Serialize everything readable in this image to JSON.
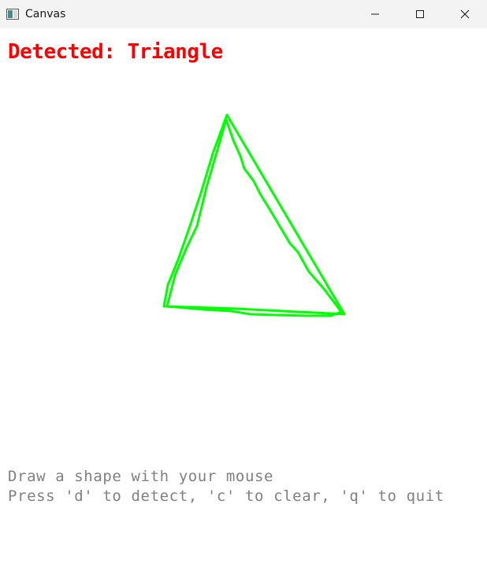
{
  "window": {
    "title": "Canvas",
    "icon": "app-window-icon",
    "controls": {
      "minimize_icon": "minimize-icon",
      "maximize_icon": "maximize-icon",
      "close_icon": "close-icon"
    }
  },
  "canvas": {
    "detected_text": "Detected: Triangle",
    "detected_color": "#ff0000",
    "stroke_color": "#00ff00",
    "shape": "Triangle",
    "instructions": [
      "Draw a shape with your mouse",
      "Press 'd' to detect, 'c' to clear, 'q' to quit"
    ],
    "instructions_color": "#808080"
  }
}
